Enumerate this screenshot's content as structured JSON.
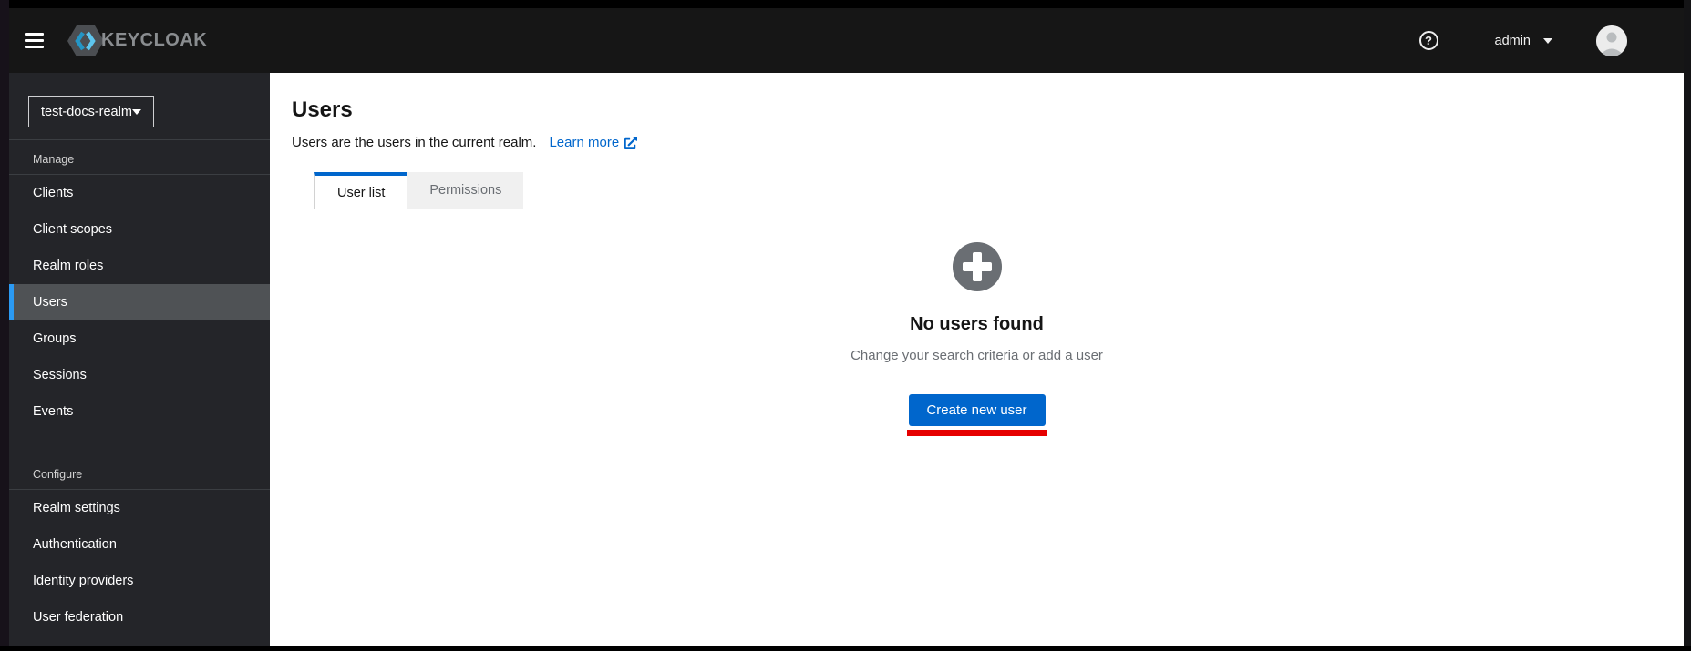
{
  "header": {
    "brand_text": "KEYCLOAK",
    "help_label": "?",
    "username": "admin"
  },
  "sidebar": {
    "realm_selector": {
      "value": "test-docs-realm"
    },
    "sections": [
      {
        "label": "Manage",
        "items": [
          {
            "label": "Clients"
          },
          {
            "label": "Client scopes"
          },
          {
            "label": "Realm roles"
          },
          {
            "label": "Users",
            "selected": true
          },
          {
            "label": "Groups"
          },
          {
            "label": "Sessions"
          },
          {
            "label": "Events"
          }
        ]
      },
      {
        "label": "Configure",
        "items": [
          {
            "label": "Realm settings"
          },
          {
            "label": "Authentication"
          },
          {
            "label": "Identity providers"
          },
          {
            "label": "User federation"
          }
        ]
      }
    ]
  },
  "main": {
    "page_title": "Users",
    "page_description": "Users are the users in the current realm.",
    "learn_more_label": "Learn more",
    "tabs": [
      {
        "label": "User list",
        "active": true
      },
      {
        "label": "Permissions",
        "active": false
      }
    ],
    "empty_state": {
      "title": "No users found",
      "body": "Change your search criteria or add a user",
      "primary_button_label": "Create new user"
    }
  },
  "colors": {
    "accent_blue": "#0066cc",
    "nav_selected_indicator": "#2b9af3",
    "annotation_red": "#e60000",
    "masthead_bg": "#161616",
    "sidebar_bg": "#242529",
    "empty_icon_gray": "#6a6e73"
  }
}
